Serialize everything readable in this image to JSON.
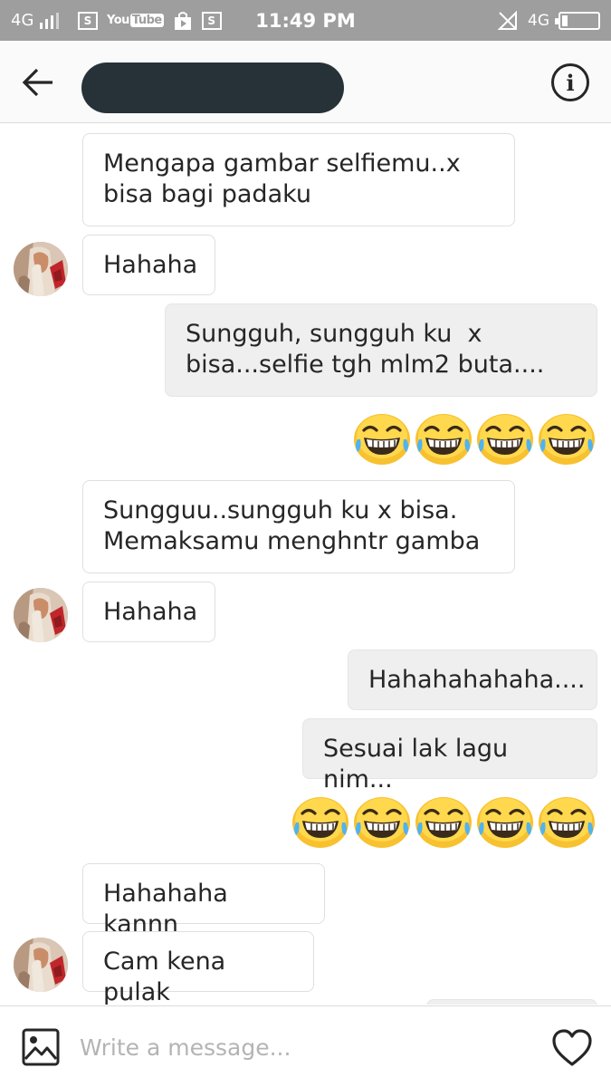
{
  "status_bar": {
    "network_type": "4G",
    "time": "11:49 PM",
    "right_network_type": "4G",
    "notification_icons": [
      "sim-s-icon",
      "youtube-icon",
      "play-store-icon",
      "sim-s-icon"
    ],
    "bg_color": "#9e9e9e"
  },
  "header": {
    "contact_name_redacted": true,
    "back_icon": "arrow-left-icon",
    "info_icon": "info-icon"
  },
  "messages": [
    {
      "sender": "them",
      "text": "Mengapa gambar selfiemu..x\nbisa bagi padaku"
    },
    {
      "sender": "them",
      "text": "Hahaha"
    },
    {
      "sender": "me",
      "text": "Sungguh, sungguh ku  x\nbisa...selfie tgh mlm2 buta...."
    },
    {
      "sender": "me",
      "emoji": "😂",
      "count": 4
    },
    {
      "sender": "them",
      "text": "Sungguu..sungguh ku x bisa.\nMemaksamu menghntr gamba"
    },
    {
      "sender": "them",
      "text": "Hahaha"
    },
    {
      "sender": "me",
      "text": "Hahahahahaha...."
    },
    {
      "sender": "me",
      "text": "Sesuai lak lagu nim..."
    },
    {
      "sender": "me",
      "emoji": "😂",
      "count": 5
    },
    {
      "sender": "them",
      "text": "Hahahaha kannn"
    },
    {
      "sender": "them",
      "text": "Cam kena pulak"
    }
  ],
  "composer": {
    "placeholder": "Write a message...",
    "gallery_icon": "image-icon",
    "like_icon": "heart-icon"
  },
  "colors": {
    "incoming_bubble": "#ffffff",
    "outgoing_bubble": "#efefef",
    "emoji_face": "#ffc83d"
  }
}
